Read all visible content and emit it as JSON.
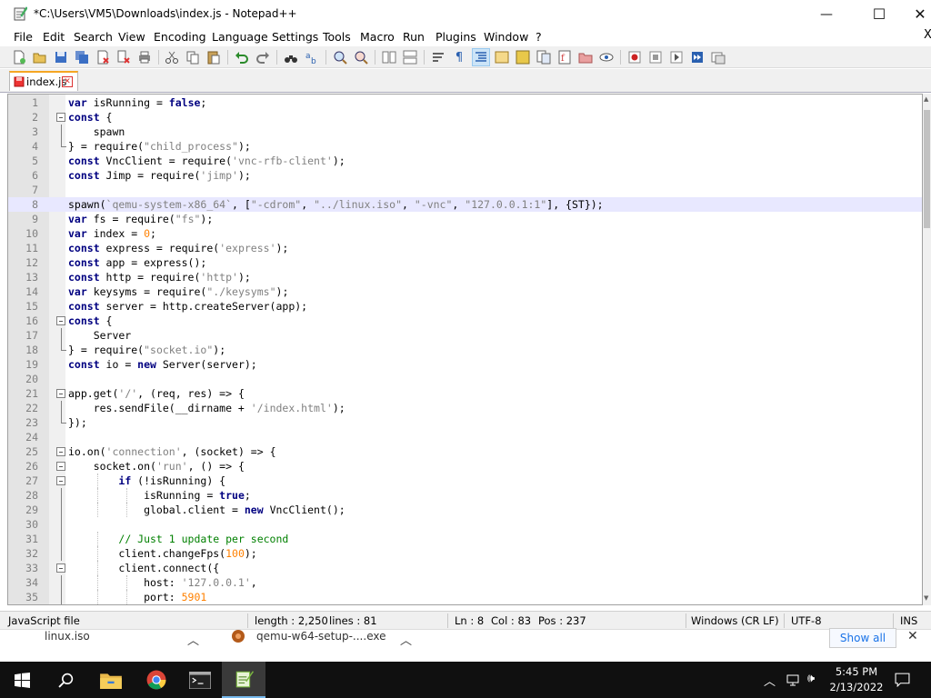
{
  "window": {
    "title": "*C:\\Users\\VM5\\Downloads\\index.js - Notepad++",
    "minimize": "—",
    "maximize": "☐",
    "close": "✕"
  },
  "menu": [
    "File",
    "Edit",
    "Search",
    "View",
    "Encoding",
    "Language",
    "Settings",
    "Tools",
    "Macro",
    "Run",
    "Plugins",
    "Window",
    "?"
  ],
  "menu_close": "X",
  "tab": {
    "label": "index.js"
  },
  "code_lines": [
    [
      [
        "kw",
        "var"
      ],
      [
        "op",
        " isRunning = "
      ],
      [
        "kw",
        "false"
      ],
      [
        "op",
        ";"
      ]
    ],
    [
      [
        "kw",
        "const"
      ],
      [
        "op",
        " {"
      ]
    ],
    [
      [
        "op",
        "    spawn"
      ]
    ],
    [
      [
        "op",
        "} = require("
      ],
      [
        "st",
        "\"child_process\""
      ],
      [
        "op",
        ");"
      ]
    ],
    [
      [
        "kw",
        "const"
      ],
      [
        "op",
        " VncClient = require("
      ],
      [
        "st",
        "'vnc-rfb-client'"
      ],
      [
        "op",
        ");"
      ]
    ],
    [
      [
        "kw",
        "const"
      ],
      [
        "op",
        " Jimp = require("
      ],
      [
        "st",
        "'jimp'"
      ],
      [
        "op",
        ");"
      ]
    ],
    [],
    [
      [
        "op",
        "spawn("
      ],
      [
        "st",
        "`qemu-system-x86_64`"
      ],
      [
        "op",
        ", ["
      ],
      [
        "st",
        "\"-cdrom\""
      ],
      [
        "op",
        ", "
      ],
      [
        "st",
        "\"../linux.iso\""
      ],
      [
        "op",
        ", "
      ],
      [
        "st",
        "\"-vnc\""
      ],
      [
        "op",
        ", "
      ],
      [
        "st",
        "\"127.0.0.1:1\""
      ],
      [
        "op",
        "], {ST});"
      ]
    ],
    [
      [
        "kw",
        "var"
      ],
      [
        "op",
        " fs = require("
      ],
      [
        "st",
        "\"fs\""
      ],
      [
        "op",
        ");"
      ]
    ],
    [
      [
        "kw",
        "var"
      ],
      [
        "op",
        " index = "
      ],
      [
        "nu",
        "0"
      ],
      [
        "op",
        ";"
      ]
    ],
    [
      [
        "kw",
        "const"
      ],
      [
        "op",
        " express = require("
      ],
      [
        "st",
        "'express'"
      ],
      [
        "op",
        ");"
      ]
    ],
    [
      [
        "kw",
        "const"
      ],
      [
        "op",
        " app = express();"
      ]
    ],
    [
      [
        "kw",
        "const"
      ],
      [
        "op",
        " http = require("
      ],
      [
        "st",
        "'http'"
      ],
      [
        "op",
        ");"
      ]
    ],
    [
      [
        "kw",
        "var"
      ],
      [
        "op",
        " keysyms = require("
      ],
      [
        "st",
        "\"./keysyms\""
      ],
      [
        "op",
        ");"
      ]
    ],
    [
      [
        "kw",
        "const"
      ],
      [
        "op",
        " server = http.createServer(app);"
      ]
    ],
    [
      [
        "kw",
        "const"
      ],
      [
        "op",
        " {"
      ]
    ],
    [
      [
        "op",
        "    Server"
      ]
    ],
    [
      [
        "op",
        "} = require("
      ],
      [
        "st",
        "\"socket.io\""
      ],
      [
        "op",
        ");"
      ]
    ],
    [
      [
        "kw",
        "const"
      ],
      [
        "op",
        " io = "
      ],
      [
        "kw",
        "new"
      ],
      [
        "op",
        " Server(server);"
      ]
    ],
    [],
    [
      [
        "op",
        "app.get("
      ],
      [
        "st",
        "'/'"
      ],
      [
        "op",
        ", (req, res) => {"
      ]
    ],
    [
      [
        "op",
        "    res.sendFile(__dirname + "
      ],
      [
        "st",
        "'/index.html'"
      ],
      [
        "op",
        ");"
      ]
    ],
    [
      [
        "op",
        "});"
      ]
    ],
    [],
    [
      [
        "op",
        "io.on("
      ],
      [
        "st",
        "'connection'"
      ],
      [
        "op",
        ", (socket) => {"
      ]
    ],
    [
      [
        "op",
        "    socket.on("
      ],
      [
        "st",
        "'run'"
      ],
      [
        "op",
        ", () => {"
      ]
    ],
    [
      [
        "op",
        "        "
      ],
      [
        "kw",
        "if"
      ],
      [
        "op",
        " (!isRunning) {"
      ]
    ],
    [
      [
        "op",
        "            isRunning = "
      ],
      [
        "kw",
        "true"
      ],
      [
        "op",
        ";"
      ]
    ],
    [
      [
        "op",
        "            global.client = "
      ],
      [
        "kw",
        "new"
      ],
      [
        "op",
        " VncClient();"
      ]
    ],
    [],
    [
      [
        "op",
        "        "
      ],
      [
        "cm",
        "// Just 1 update per second"
      ]
    ],
    [
      [
        "op",
        "        client.changeFps("
      ],
      [
        "nu",
        "100"
      ],
      [
        "op",
        ");"
      ]
    ],
    [
      [
        "op",
        "        client.connect({"
      ]
    ],
    [
      [
        "op",
        "            host: "
      ],
      [
        "st",
        "'127.0.0.1'"
      ],
      [
        "op",
        ","
      ]
    ],
    [
      [
        "op",
        "            port: "
      ],
      [
        "nu",
        "5901"
      ]
    ]
  ],
  "status": {
    "type": "JavaScript file",
    "length": "length : 2,250",
    "lines": "lines : 81",
    "ln": "Ln : 8",
    "col": "Col : 83",
    "pos": "Pos : 237",
    "eol": "Windows (CR LF)",
    "encoding": "UTF-8",
    "mode": "INS"
  },
  "downloads": {
    "item1": "linux.iso",
    "item2": "qemu-w64-setup-....exe",
    "show_all": "Show all"
  },
  "taskbar": {
    "time": "5:45 PM",
    "date": "2/13/2022"
  }
}
